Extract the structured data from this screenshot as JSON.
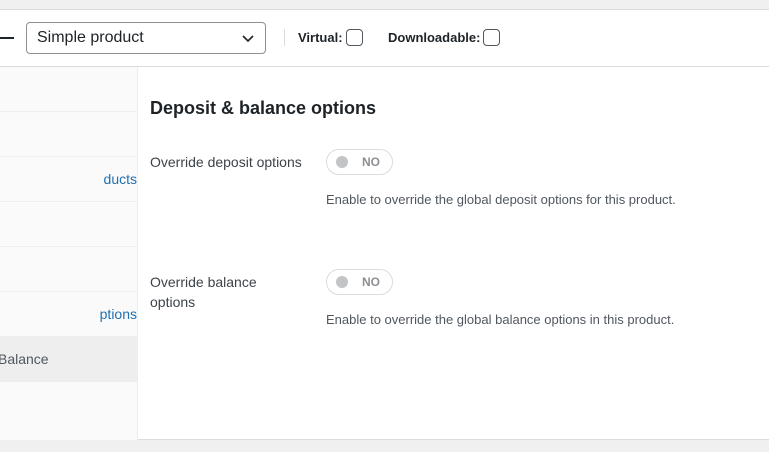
{
  "header": {
    "product_type": "Simple product",
    "virtual_label": "Virtual:",
    "downloadable_label": "Downloadable:"
  },
  "sidebar": {
    "items": [
      {
        "label": ""
      },
      {
        "label": ""
      },
      {
        "label": "ducts"
      },
      {
        "label": ""
      },
      {
        "label": ""
      },
      {
        "label": "ptions"
      },
      {
        "label": "Balance"
      }
    ]
  },
  "content": {
    "title": "Deposit & balance options",
    "deposit": {
      "label": "Override deposit options",
      "toggle": "NO",
      "description": "Enable to override the global deposit options for this product."
    },
    "balance": {
      "label": "Override balance options",
      "toggle": "NO",
      "description": "Enable to override the global balance options in this product."
    }
  }
}
